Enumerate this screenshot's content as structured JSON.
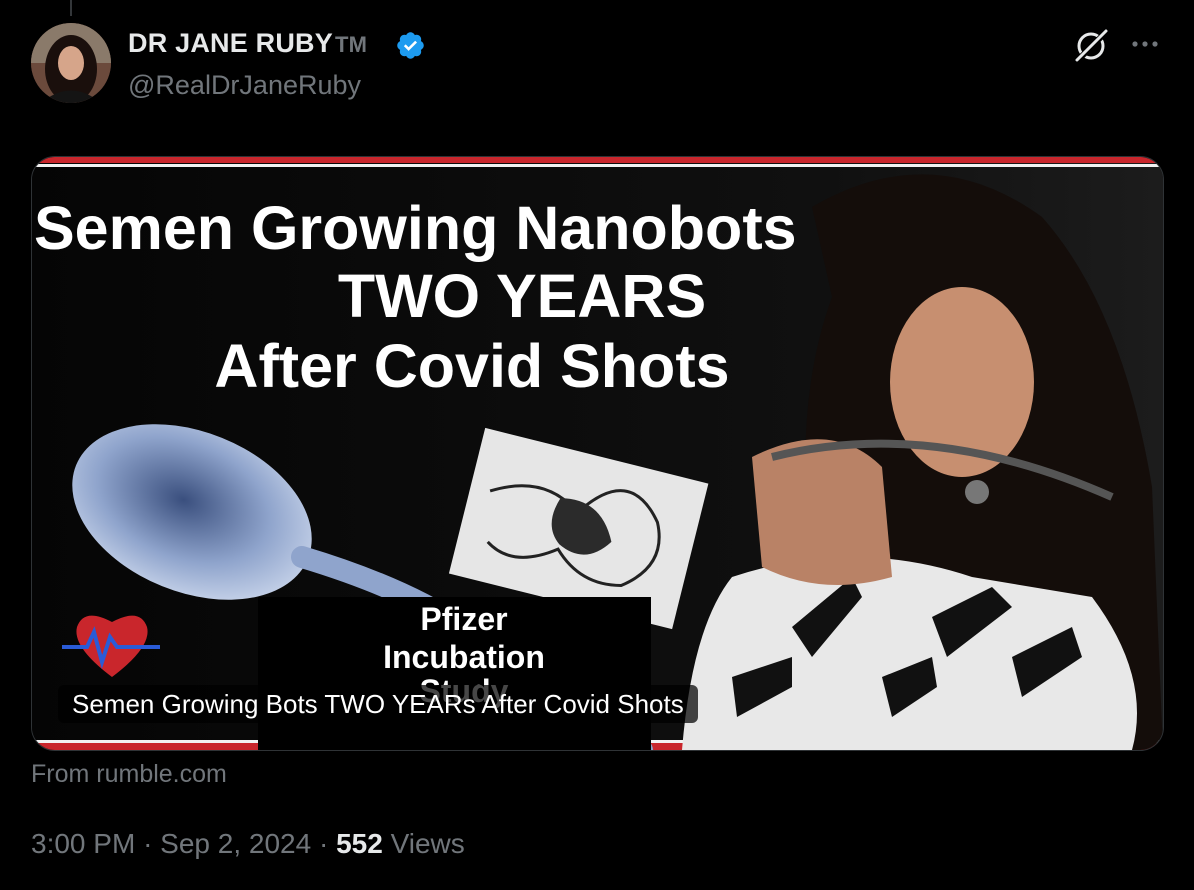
{
  "author": {
    "display_name": "DR JANE RUBY",
    "tm": "TM",
    "handle": "@RealDrJaneRuby"
  },
  "icons": {
    "verified": "verified-badge-icon",
    "grok": "grok-icon",
    "more": "more-options-icon"
  },
  "colors": {
    "background": "#000000",
    "text": "#e7e9ea",
    "secondary": "#71767b",
    "verified": "#1d9bf0"
  },
  "card": {
    "headline_line1": "Semen Growing Nanobots",
    "headline_line2": "TWO YEARS",
    "headline_line3": "After Covid Shots",
    "box_line1": "Pfizer",
    "box_line2": "Incubation",
    "box_line3": "Study",
    "caption": "Semen Growing Bots TWO YEARs After Covid Shots",
    "source": "From rumble.com"
  },
  "meta": {
    "time": "3:00 PM",
    "separator": "·",
    "date": "Sep 2, 2024",
    "views_count": "552",
    "views_label": "Views"
  }
}
